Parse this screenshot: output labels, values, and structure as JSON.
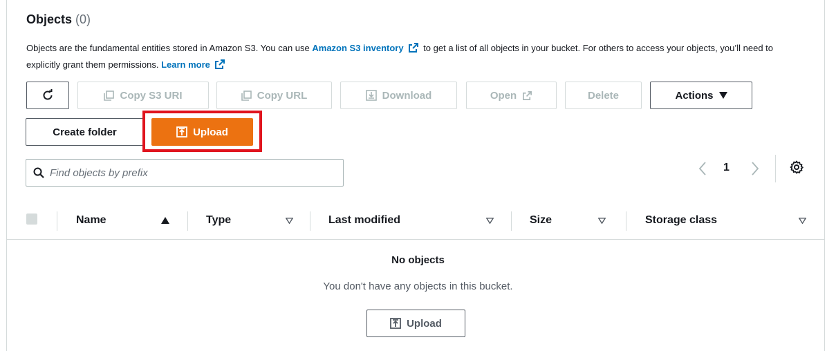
{
  "header": {
    "title": "Objects",
    "count": "(0)"
  },
  "description": {
    "text1": "Objects are the fundamental entities stored in Amazon S3. You can use ",
    "inventory_link": "Amazon S3 inventory",
    "text2": " to get a list of all objects in your bucket. For others to access your objects, you’ll need to explicitly grant them permissions. ",
    "learn_more_link": "Learn more"
  },
  "toolbar": {
    "copy_s3_uri": "Copy S3 URI",
    "copy_url": "Copy URL",
    "download": "Download",
    "open": "Open",
    "delete": "Delete",
    "actions": "Actions",
    "create_folder": "Create folder",
    "upload": "Upload"
  },
  "search": {
    "placeholder": "Find objects by prefix"
  },
  "pagination": {
    "current_page": "1"
  },
  "table": {
    "columns": [
      "Name",
      "Type",
      "Last modified",
      "Size",
      "Storage class"
    ],
    "empty_title": "No objects",
    "empty_message": "You don't have any objects in this bucket.",
    "empty_upload": "Upload"
  },
  "colors": {
    "primary": "#ec7211",
    "link": "#0073bb",
    "highlight": "#e0141e"
  }
}
